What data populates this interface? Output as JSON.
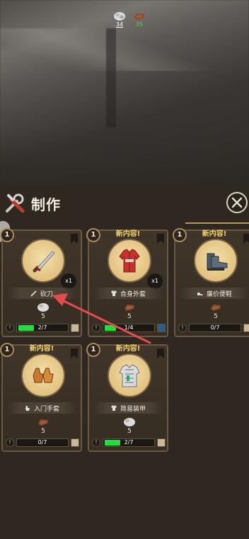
{
  "resources": [
    {
      "icon": "cloth-icon",
      "count": "34"
    },
    {
      "icon": "leather-icon",
      "count": "35"
    }
  ],
  "panel": {
    "title": "制作"
  },
  "cards": [
    {
      "level": "1",
      "new_tag": "",
      "name": "砍刀",
      "item_icon": "machete-icon",
      "qty": "x1",
      "material_icon": "cloth-icon",
      "material_count": "5",
      "progress_text": "2/7",
      "progress": 0.29,
      "has_new": false
    },
    {
      "level": "1",
      "new_tag": "新内容!",
      "name": "合身外套",
      "item_icon": "jacket-icon",
      "qty": "x1",
      "material_icon": "leather-icon",
      "material_count": "5",
      "progress_text": "1/4",
      "progress": 0.25,
      "has_new": true
    },
    {
      "level": "1",
      "new_tag": "新内容!",
      "name": "廉价便鞋",
      "item_icon": "boots-icon",
      "qty": "",
      "material_icon": "leather-icon",
      "material_count": "5",
      "progress_text": "0/7",
      "progress": 0,
      "has_new": true
    },
    {
      "level": "1",
      "new_tag": "新内容!",
      "name": "入门手套",
      "item_icon": "gloves-icon",
      "qty": "",
      "material_icon": "leather-icon",
      "material_count": "5",
      "progress_text": "0/7",
      "progress": 0,
      "has_new": true
    },
    {
      "level": "1",
      "new_tag": "新内容!",
      "name": "简易装甲",
      "item_icon": "armor-icon",
      "qty": "",
      "material_icon": "cloth-icon",
      "material_count": "5",
      "progress_text": "2/7",
      "progress": 0.29,
      "has_new": true
    }
  ],
  "colors": {
    "accent_new": "#f5d36a",
    "progress_green": "#1ee03a",
    "annotation_arrow": "#e84a4a"
  }
}
